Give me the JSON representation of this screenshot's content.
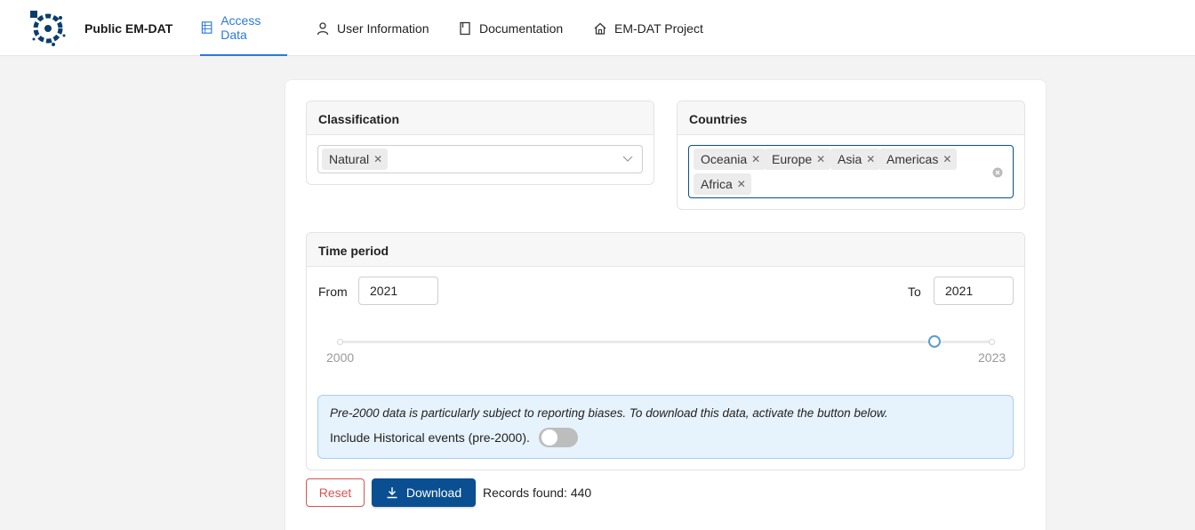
{
  "nav": {
    "brand": "Public EM-DAT",
    "items": [
      {
        "label": "Access Data",
        "icon": "table-icon",
        "active": true
      },
      {
        "label": "User Information",
        "icon": "user-icon",
        "active": false
      },
      {
        "label": "Documentation",
        "icon": "book-icon",
        "active": false
      },
      {
        "label": "EM-DAT Project",
        "icon": "home-icon",
        "active": false
      }
    ]
  },
  "classification": {
    "title": "Classification",
    "chips": [
      "Natural"
    ]
  },
  "countries": {
    "title": "Countries",
    "chips": [
      "Oceania",
      "Europe",
      "Asia",
      "Americas",
      "Africa"
    ]
  },
  "time_period": {
    "title": "Time period",
    "from_label": "From",
    "from_value": "2021",
    "to_label": "To",
    "to_value": "2021",
    "slider_min": "2000",
    "slider_max": "2023",
    "slider_value": 2021
  },
  "info": {
    "message": "Pre-2000 data is particularly subject to reporting biases. To download this data, activate the button below.",
    "toggle_label": "Include Historical events (pre-2000).",
    "toggle_on": false
  },
  "actions": {
    "reset_label": "Reset",
    "download_label": "Download",
    "records_text": "Records found: 440"
  },
  "colors": {
    "accent": "#2a7ad8",
    "primary_button": "#0a4f91",
    "reset": "#d9534f",
    "info_bg": "#e6f2fc"
  }
}
